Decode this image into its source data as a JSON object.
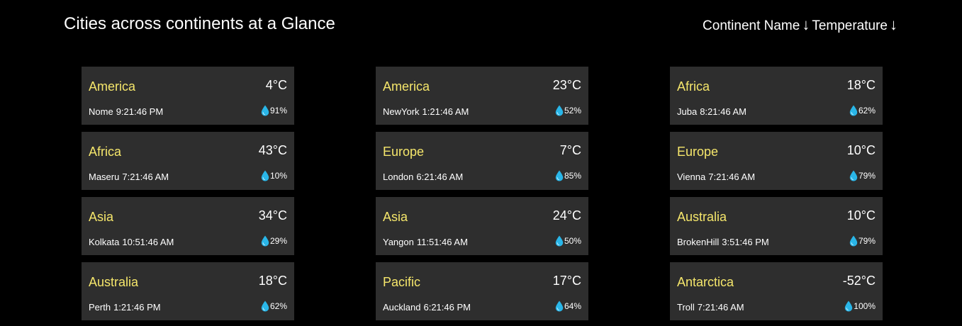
{
  "header": {
    "title": "Cities across continents at a Glance",
    "sort_continent_label": "Continent Name",
    "sort_temperature_label": "Temperature",
    "sort_arrow": "↓"
  },
  "colors": {
    "background": "#000000",
    "card": "#2e2e2e",
    "continent_text": "#f5e66b",
    "humidity_drop": "#29b6e8"
  },
  "cards": [
    {
      "continent": "America",
      "temp": "4°C",
      "city": "Nome",
      "time": "9:21:46 PM",
      "humidity": "91%"
    },
    {
      "continent": "America",
      "temp": "23°C",
      "city": "NewYork",
      "time": "1:21:46 AM",
      "humidity": "52%"
    },
    {
      "continent": "Africa",
      "temp": "18°C",
      "city": "Juba",
      "time": "8:21:46 AM",
      "humidity": "62%"
    },
    {
      "continent": "Africa",
      "temp": "43°C",
      "city": "Maseru",
      "time": "7:21:46 AM",
      "humidity": "10%"
    },
    {
      "continent": "Europe",
      "temp": "7°C",
      "city": "London",
      "time": "6:21:46 AM",
      "humidity": "85%"
    },
    {
      "continent": "Europe",
      "temp": "10°C",
      "city": "Vienna",
      "time": "7:21:46 AM",
      "humidity": "79%"
    },
    {
      "continent": "Asia",
      "temp": "34°C",
      "city": "Kolkata",
      "time": "10:51:46 AM",
      "humidity": "29%"
    },
    {
      "continent": "Asia",
      "temp": "24°C",
      "city": "Yangon",
      "time": "11:51:46 AM",
      "humidity": "50%"
    },
    {
      "continent": "Australia",
      "temp": "10°C",
      "city": "BrokenHill",
      "time": "3:51:46 PM",
      "humidity": "79%"
    },
    {
      "continent": "Australia",
      "temp": "18°C",
      "city": "Perth",
      "time": "1:21:46 PM",
      "humidity": "62%"
    },
    {
      "continent": "Pacific",
      "temp": "17°C",
      "city": "Auckland",
      "time": "6:21:46 PM",
      "humidity": "64%"
    },
    {
      "continent": "Antarctica",
      "temp": "-52°C",
      "city": "Troll",
      "time": "7:21:46 AM",
      "humidity": "100%"
    }
  ]
}
